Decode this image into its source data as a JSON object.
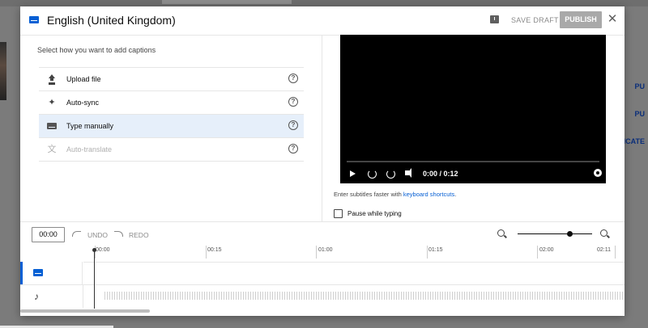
{
  "dialog": {
    "title": "English (United Kingdom)",
    "save_draft": "SAVE DRAFT",
    "publish": "PUBLISH",
    "close": "✕"
  },
  "caption_methods": {
    "prompt": "Select how you want to add captions",
    "options": [
      {
        "label": "Upload file",
        "icon": "upload-icon",
        "state": "enabled"
      },
      {
        "label": "Auto-sync",
        "icon": "sparkle-icon",
        "state": "enabled"
      },
      {
        "label": "Type manually",
        "icon": "keyboard-icon",
        "state": "selected"
      },
      {
        "label": "Auto-translate",
        "icon": "translate-icon",
        "state": "disabled"
      }
    ],
    "help_glyph": "?"
  },
  "player": {
    "time": "0:00 / 0:12",
    "hint_prefix": "Enter subtitles faster with ",
    "hint_link": "keyboard shortcuts",
    "hint_suffix": ".",
    "pause_label": "Pause while typing"
  },
  "timeline": {
    "current_time": "00:00",
    "undo": "UNDO",
    "redo": "REDO",
    "ruler": [
      "00:00",
      "00:15",
      "01:00",
      "01:15",
      "02:00",
      "02:11"
    ]
  },
  "background": {
    "right_labels": [
      "PU",
      "PU",
      "PLICATE"
    ]
  },
  "colors": {
    "accent": "#065fd4",
    "selected_row": "#e6effa",
    "publish_disabled": "#a9a9a9"
  }
}
